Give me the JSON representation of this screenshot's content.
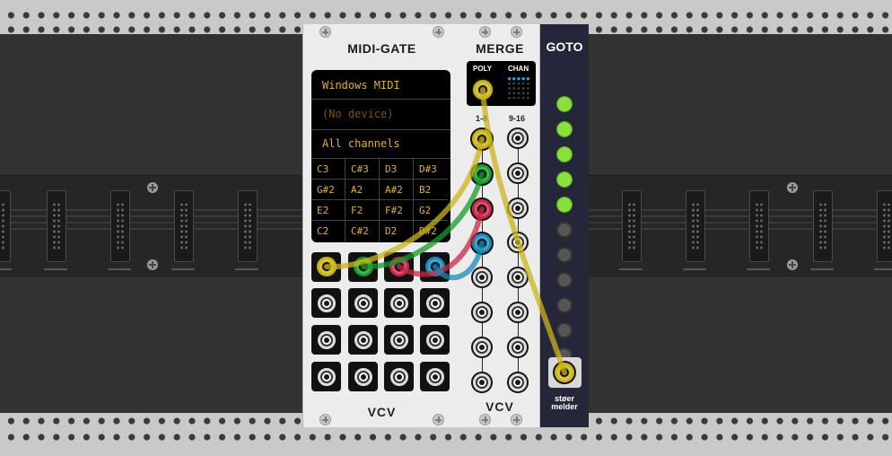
{
  "modules": {
    "midi_gate": {
      "title": "MIDI-GATE",
      "brand": "VCV",
      "driver": "Windows MIDI",
      "device": "(No device)",
      "channel": "All channels",
      "notes": [
        "C3",
        "C#3",
        "D3",
        "D#3",
        "G#2",
        "A2",
        "A#2",
        "B2",
        "E2",
        "F2",
        "F#2",
        "G2",
        "C2",
        "C#2",
        "D2",
        "D#2"
      ]
    },
    "merge": {
      "title": "MERGE",
      "brand": "VCV",
      "poly_label": "POLY",
      "chan_label": "CHAN",
      "col_left_label": "1-8",
      "col_right_label": "9-16"
    },
    "goto": {
      "title": "GOTO",
      "brand_line1": "støer",
      "brand_line2": "melder",
      "leds": [
        "on",
        "on",
        "on",
        "on",
        "on",
        "off",
        "off",
        "off",
        "off",
        "off",
        "off",
        "off"
      ]
    }
  },
  "colors": {
    "cable_yellow": "#c9b41a",
    "cable_green": "#1a9a2a",
    "cable_red": "#c8284a",
    "cable_blue": "#1a8ab8",
    "display_text": "#e0b030",
    "led_on": "#8ae03a"
  }
}
